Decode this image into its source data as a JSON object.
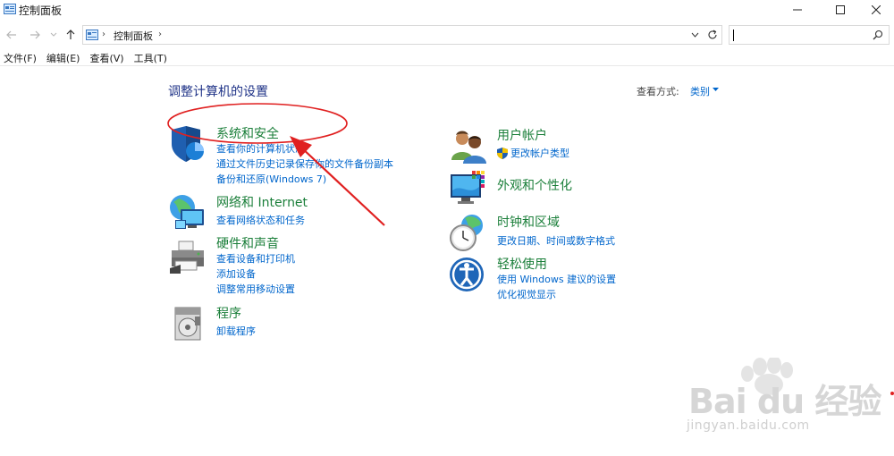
{
  "window": {
    "title": "控制面板",
    "icon": "control-panel-icon"
  },
  "address": {
    "breadcrumb": "控制面板",
    "search_placeholder": ""
  },
  "menu": [
    "文件(F)",
    "编辑(E)",
    "查看(V)",
    "工具(T)"
  ],
  "main": {
    "title": "调整计算机的设置",
    "view_by_label": "查看方式:",
    "view_by_value": "类别"
  },
  "categories_left": [
    {
      "title": "系统和安全",
      "icon": "shield-icon",
      "links": [
        "查看你的计算机状态",
        "通过文件历史记录保存你的文件备份副本",
        "备份和还原(Windows 7)"
      ]
    },
    {
      "title": "网络和 Internet",
      "icon": "network-globe-icon",
      "links": [
        "查看网络状态和任务"
      ]
    },
    {
      "title": "硬件和声音",
      "icon": "printer-icon",
      "links": [
        "查看设备和打印机",
        "添加设备",
        "调整常用移动设置"
      ]
    },
    {
      "title": "程序",
      "icon": "programs-disk-icon",
      "links": [
        "卸载程序"
      ]
    }
  ],
  "categories_right": [
    {
      "title": "用户帐户",
      "icon": "users-icon",
      "links": [
        "更改帐户类型"
      ]
    },
    {
      "title": "外观和个性化",
      "icon": "monitor-color-icon",
      "links": []
    },
    {
      "title": "时钟和区域",
      "icon": "clock-globe-icon",
      "links": [
        "更改日期、时间或数字格式"
      ]
    },
    {
      "title": "轻松使用",
      "icon": "ease-of-access-icon",
      "links": [
        "使用 Windows 建议的设置",
        "优化视觉显示"
      ]
    }
  ],
  "watermark": {
    "brand": "Bai du 经验",
    "url": "jingyan.baidu.com"
  },
  "colors": {
    "category_title": "#1b7f3a",
    "link": "#0066cc",
    "page_title": "#1e3287",
    "annotation": "#e02020"
  }
}
